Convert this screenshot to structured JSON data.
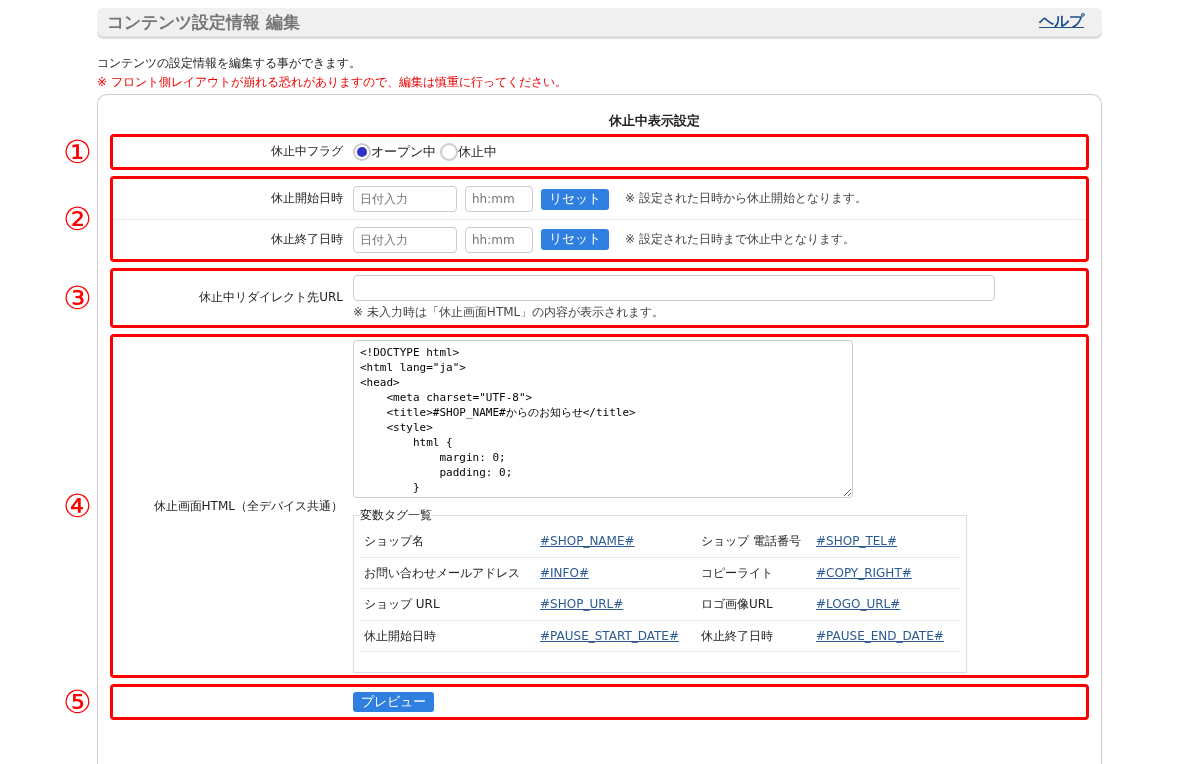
{
  "header": {
    "title": "コンテンツ設定情報 編集",
    "help_link": "ヘルプ"
  },
  "description": "コンテンツの設定情報を編集する事ができます。",
  "warning": "※ フロント側レイアウトが崩れる恐れがありますので、編集は慎重に行ってください。",
  "section": {
    "title": "休止中表示設定",
    "groups": [
      {
        "marker": "①",
        "rows": [
          {
            "kind": "radio",
            "label": "休止中フラグ",
            "options": [
              {
                "label": "オープン中",
                "selected": true
              },
              {
                "label": "休止中",
                "selected": false
              }
            ]
          }
        ]
      },
      {
        "marker": "②",
        "rows": [
          {
            "kind": "datetime",
            "label": "休止開始日時",
            "date_placeholder": "日付入力",
            "time_placeholder": "hh:mm",
            "button": "リセット",
            "note": "※ 設定された日時から休止開始となります。"
          },
          {
            "kind": "datetime",
            "label": "休止終了日時",
            "date_placeholder": "日付入力",
            "time_placeholder": "hh:mm",
            "button": "リセット",
            "note": "※ 設定された日時まで休止中となります。"
          }
        ]
      },
      {
        "marker": "③",
        "rows": [
          {
            "kind": "url",
            "label": "休止中リダイレクト先URL",
            "note": "※ 未入力時は「休止画面HTML」の内容が表示されます。"
          }
        ]
      },
      {
        "marker": "④",
        "rows": [
          {
            "kind": "html",
            "label": "休止画面HTML（全デバイス共通）",
            "value": "<!DOCTYPE html>\n<html lang=\"ja\">\n<head>\n    <meta charset=\"UTF-8\">\n    <title>#SHOP_NAME#からのお知らせ</title>\n    <style>\n        html {\n            margin: 0;\n            padding: 0;\n        }",
            "legend": "変数タグ一覧",
            "tags": [
              {
                "name": "ショップ名",
                "tag": "#SHOP_NAME#"
              },
              {
                "name": "ショップ 電話番号",
                "tag": "#SHOP_TEL#"
              },
              {
                "name": "お問い合わせメールアドレス",
                "tag": "#INFO#"
              },
              {
                "name": "コピーライト",
                "tag": "#COPY_RIGHT#"
              },
              {
                "name": "ショップ URL",
                "tag": "#SHOP_URL#"
              },
              {
                "name": "ロゴ画像URL",
                "tag": "#LOGO_URL#"
              },
              {
                "name": "休止開始日時",
                "tag": "#PAUSE_START_DATE#"
              },
              {
                "name": "休止終了日時",
                "tag": "#PAUSE_END_DATE#"
              }
            ]
          }
        ]
      },
      {
        "marker": "⑤",
        "rows": [
          {
            "kind": "preview",
            "button": "プレビュー"
          }
        ]
      }
    ]
  }
}
